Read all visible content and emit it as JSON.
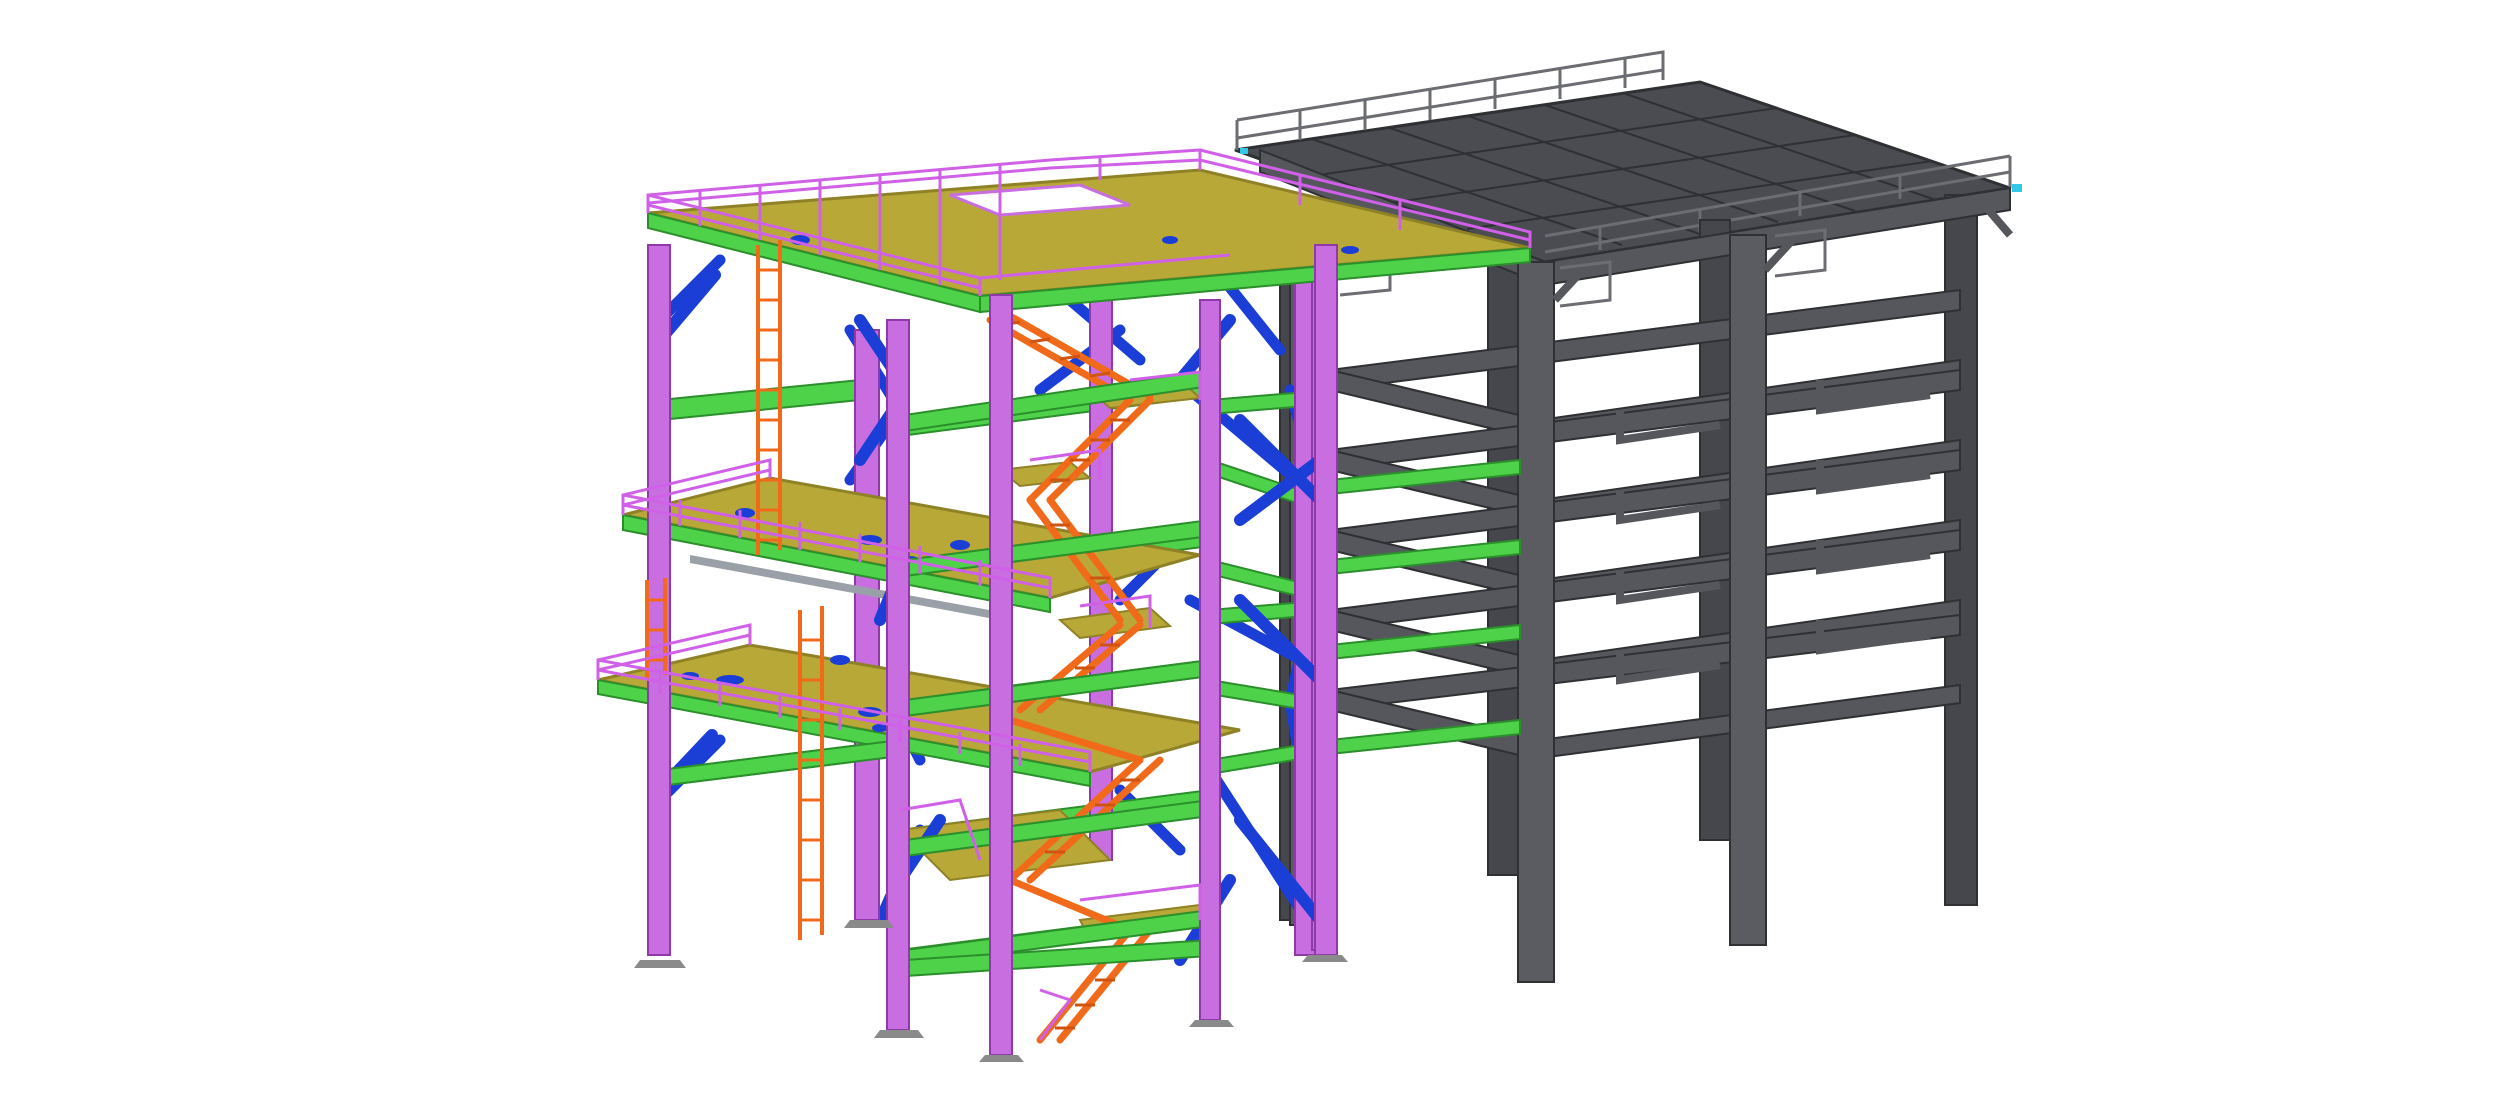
{
  "scene": {
    "background": "#ffffff"
  },
  "colors": {
    "column_steel": "#c86ee0",
    "column_steel_edge": "#8e3aa8",
    "beam_green": "#4ed24a",
    "beam_green_edge": "#2b8f2b",
    "brace_blue": "#1a3ed6",
    "grating_olive": "#b8a838",
    "grating_edge": "#8f8226",
    "stair_orange": "#f06a1a",
    "handrail_magenta": "#d060e8",
    "existing_structure": "#55575c",
    "existing_structure_dark": "#3d3f44",
    "existing_handrail": "#6b6d72",
    "cyan_detail": "#33c8e8",
    "base_plate": "#8a8a8a"
  },
  "icons": [
    "column-icon",
    "beam-icon",
    "brace-icon",
    "stair-icon",
    "ladder-icon",
    "handrail-icon",
    "platform-icon"
  ]
}
